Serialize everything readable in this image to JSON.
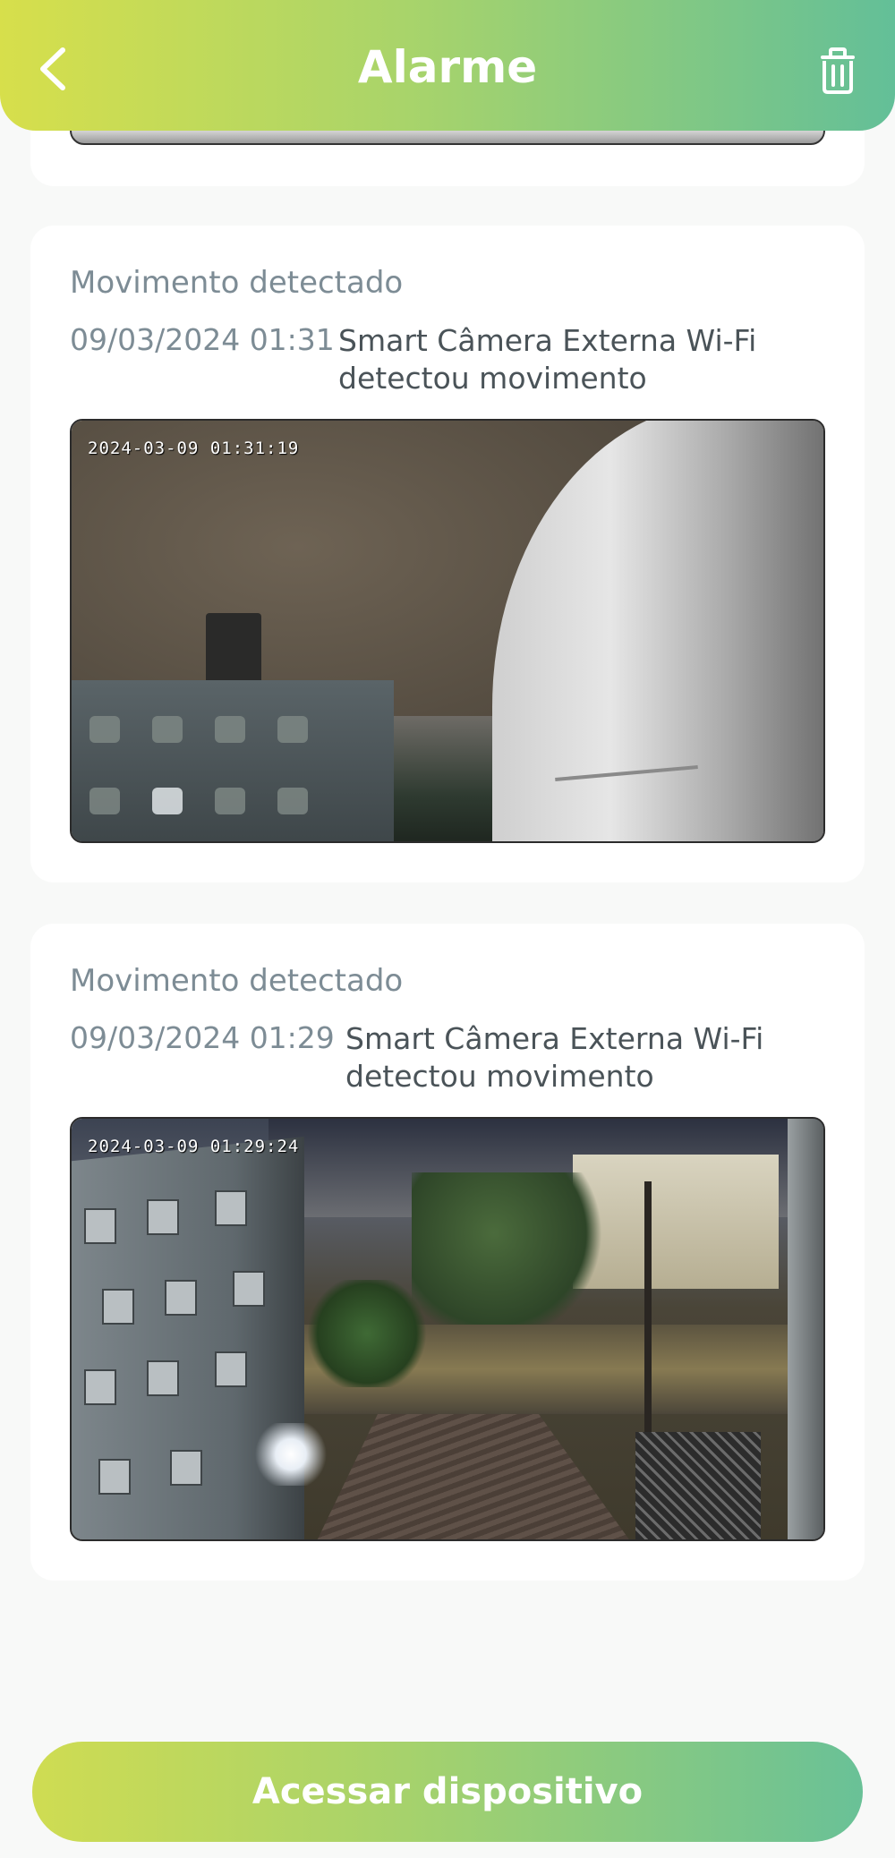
{
  "header": {
    "title": "Alarme",
    "back_icon": "chevron-left-icon",
    "delete_icon": "trash-icon",
    "gradient": [
      "#d7df4b",
      "#63bf98"
    ]
  },
  "events": [
    {
      "type": "Movimento detectado",
      "time": "09/03/2024 01:31",
      "description": "Smart Câmera Externa Wi-Fi detectou movimento",
      "overlay_timestamp": "2024-03-09 01:31:19"
    },
    {
      "type": "Movimento detectado",
      "time": "09/03/2024 01:29",
      "description": "Smart Câmera Externa Wi-Fi detectou movimento",
      "overlay_timestamp": "2024-03-09 01:29:24"
    }
  ],
  "footer": {
    "action_label": "Acessar dispositivo"
  }
}
